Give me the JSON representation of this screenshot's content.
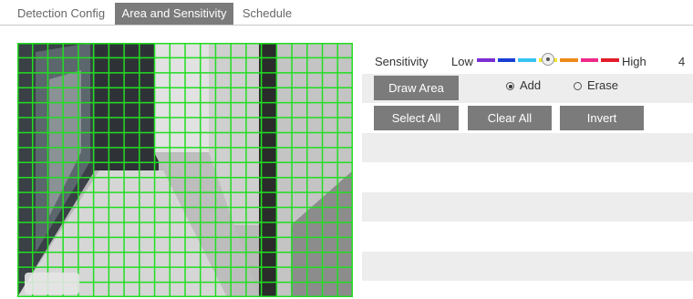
{
  "tabs": [
    {
      "label": "Detection Config",
      "active": false
    },
    {
      "label": "Area and Sensitivity",
      "active": true
    },
    {
      "label": "Schedule",
      "active": false
    }
  ],
  "sensitivity": {
    "label": "Sensitivity",
    "low_label": "Low",
    "high_label": "High",
    "value": "4",
    "colors": [
      "#7b2fd3",
      "#1a3fd6",
      "#35c4f0",
      "#f2e52a",
      "#ef8a1a",
      "#ee2a8a",
      "#e21c2a"
    ]
  },
  "buttons": {
    "draw_area": "Draw Area",
    "select_all": "Select All",
    "clear_all": "Clear All",
    "invert": "Invert"
  },
  "mode": {
    "add_label": "Add",
    "erase_label": "Erase",
    "selected": "add"
  },
  "grid": {
    "columns": 22,
    "rows": 17,
    "color": "#22dd22",
    "all_selected": true
  }
}
